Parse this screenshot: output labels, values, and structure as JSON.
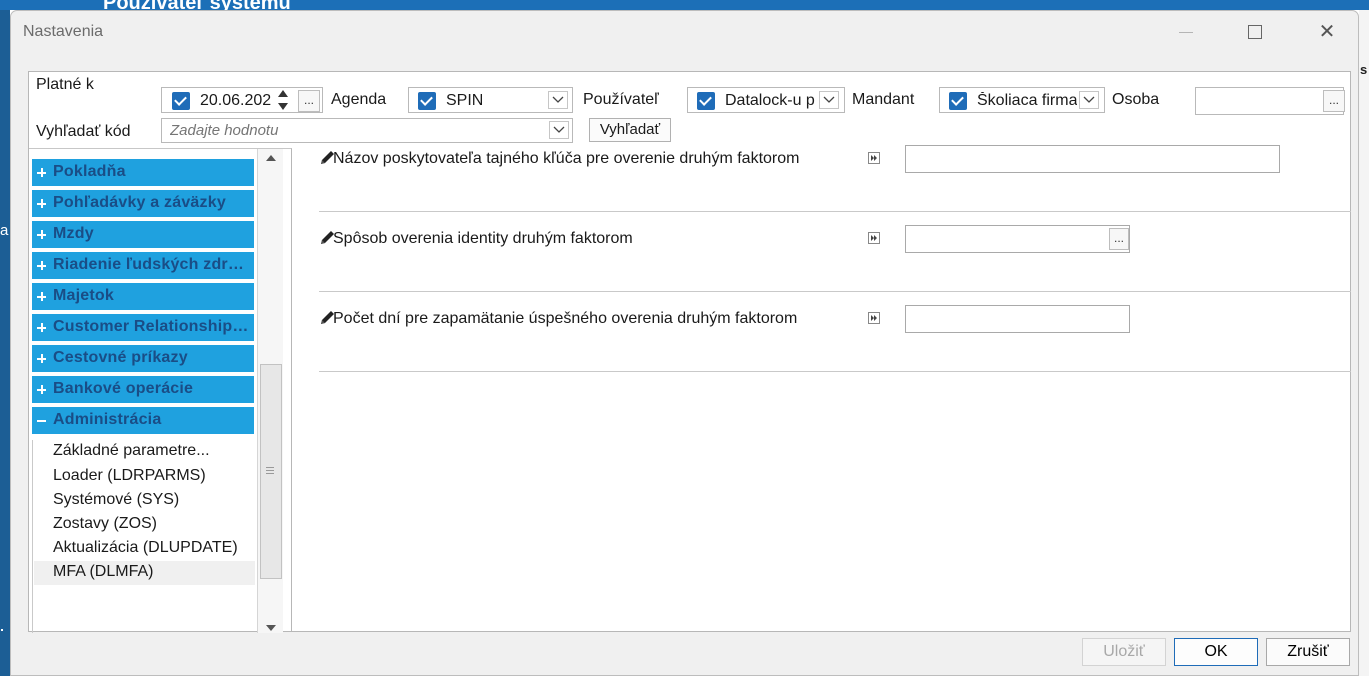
{
  "background": {
    "title": "Používateľ systému",
    "left_letter": "a",
    "right_letter": "s"
  },
  "dialog": {
    "title": "Nastavenia",
    "window_controls": {
      "minimize_icon": "minimize-icon",
      "maximize_icon": "maximize-icon",
      "close_icon": "close-icon",
      "close_glyph": "✕"
    }
  },
  "filters": {
    "valid_from": {
      "label": "Platné k",
      "value": "20.06.202",
      "checked": true,
      "button": "..."
    },
    "agenda": {
      "label": "Agenda",
      "value": "SPIN",
      "checked": true
    },
    "user": {
      "label": "Používateľ",
      "value": "Datalock-u p",
      "checked": true
    },
    "mandant": {
      "label": "Mandant",
      "value": "Školiaca firma",
      "checked": true
    },
    "person": {
      "label": "Osoba",
      "value": "",
      "button": "..."
    },
    "search_code": {
      "label": "Vyhľadať kód",
      "placeholder": "Zadajte hodnotu",
      "button": "Vyhľadať"
    }
  },
  "tree": {
    "categories": [
      {
        "label": "Pokladňa",
        "expanded": false
      },
      {
        "label": "Pohľadávky a záväzky",
        "expanded": false
      },
      {
        "label": "Mzdy",
        "expanded": false
      },
      {
        "label": "Riadenie ľudských zdrojov",
        "expanded": false
      },
      {
        "label": "Majetok",
        "expanded": false
      },
      {
        "label": "Customer Relationship Management",
        "expanded": false
      },
      {
        "label": "Cestovné príkazy",
        "expanded": false
      },
      {
        "label": "Bankové operácie",
        "expanded": false
      },
      {
        "label": "Administrácia",
        "expanded": true
      }
    ],
    "children": [
      {
        "label": "Základné  parametre..."
      },
      {
        "label": "Loader (LDRPARMS)"
      },
      {
        "label": "Systémové (SYS)"
      },
      {
        "label": "Zostavy (ZOS)"
      },
      {
        "label": "Aktualizácia (DLUPDATE)"
      },
      {
        "label": "MFA (DLMFA)",
        "selected": true
      }
    ]
  },
  "settings": [
    {
      "label": "Názov poskytovateľa tajného kľúča pre overenie druhým faktorom",
      "value": "",
      "has_button": false
    },
    {
      "label": "Spôsob overenia identity druhým faktorom",
      "value": "",
      "has_button": true,
      "button": "..."
    },
    {
      "label": "Počet dní pre zapamätanie úspešného overenia druhým faktorom",
      "value": "",
      "has_button": false
    }
  ],
  "footer": {
    "save": "Uložiť",
    "ok": "OK",
    "cancel": "Zrušiť"
  },
  "colors": {
    "category_bg": "#1fa1df",
    "category_text": "#1a4d86",
    "checkbox": "#1f6cb8",
    "accent": "#1f6cb8"
  }
}
